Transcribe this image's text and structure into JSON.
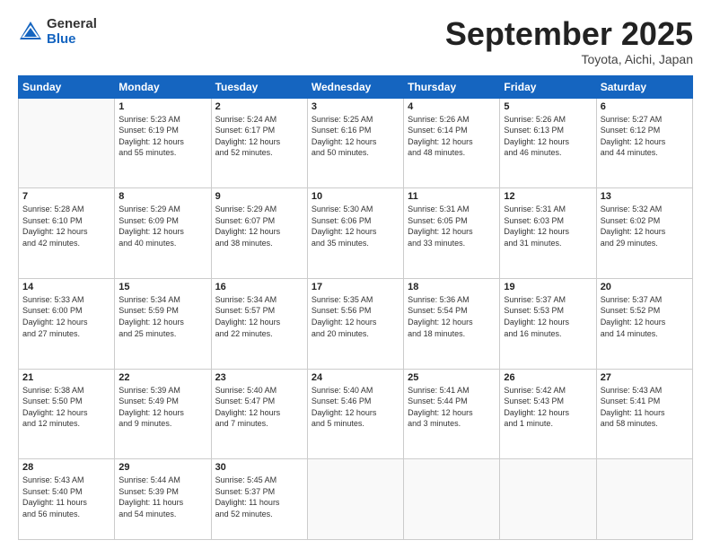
{
  "header": {
    "logo_general": "General",
    "logo_blue": "Blue",
    "month_title": "September 2025",
    "location": "Toyota, Aichi, Japan"
  },
  "calendar": {
    "days": [
      "Sunday",
      "Monday",
      "Tuesday",
      "Wednesday",
      "Thursday",
      "Friday",
      "Saturday"
    ],
    "weeks": [
      [
        {
          "day": "",
          "info": ""
        },
        {
          "day": "1",
          "info": "Sunrise: 5:23 AM\nSunset: 6:19 PM\nDaylight: 12 hours\nand 55 minutes."
        },
        {
          "day": "2",
          "info": "Sunrise: 5:24 AM\nSunset: 6:17 PM\nDaylight: 12 hours\nand 52 minutes."
        },
        {
          "day": "3",
          "info": "Sunrise: 5:25 AM\nSunset: 6:16 PM\nDaylight: 12 hours\nand 50 minutes."
        },
        {
          "day": "4",
          "info": "Sunrise: 5:26 AM\nSunset: 6:14 PM\nDaylight: 12 hours\nand 48 minutes."
        },
        {
          "day": "5",
          "info": "Sunrise: 5:26 AM\nSunset: 6:13 PM\nDaylight: 12 hours\nand 46 minutes."
        },
        {
          "day": "6",
          "info": "Sunrise: 5:27 AM\nSunset: 6:12 PM\nDaylight: 12 hours\nand 44 minutes."
        }
      ],
      [
        {
          "day": "7",
          "info": "Sunrise: 5:28 AM\nSunset: 6:10 PM\nDaylight: 12 hours\nand 42 minutes."
        },
        {
          "day": "8",
          "info": "Sunrise: 5:29 AM\nSunset: 6:09 PM\nDaylight: 12 hours\nand 40 minutes."
        },
        {
          "day": "9",
          "info": "Sunrise: 5:29 AM\nSunset: 6:07 PM\nDaylight: 12 hours\nand 38 minutes."
        },
        {
          "day": "10",
          "info": "Sunrise: 5:30 AM\nSunset: 6:06 PM\nDaylight: 12 hours\nand 35 minutes."
        },
        {
          "day": "11",
          "info": "Sunrise: 5:31 AM\nSunset: 6:05 PM\nDaylight: 12 hours\nand 33 minutes."
        },
        {
          "day": "12",
          "info": "Sunrise: 5:31 AM\nSunset: 6:03 PM\nDaylight: 12 hours\nand 31 minutes."
        },
        {
          "day": "13",
          "info": "Sunrise: 5:32 AM\nSunset: 6:02 PM\nDaylight: 12 hours\nand 29 minutes."
        }
      ],
      [
        {
          "day": "14",
          "info": "Sunrise: 5:33 AM\nSunset: 6:00 PM\nDaylight: 12 hours\nand 27 minutes."
        },
        {
          "day": "15",
          "info": "Sunrise: 5:34 AM\nSunset: 5:59 PM\nDaylight: 12 hours\nand 25 minutes."
        },
        {
          "day": "16",
          "info": "Sunrise: 5:34 AM\nSunset: 5:57 PM\nDaylight: 12 hours\nand 22 minutes."
        },
        {
          "day": "17",
          "info": "Sunrise: 5:35 AM\nSunset: 5:56 PM\nDaylight: 12 hours\nand 20 minutes."
        },
        {
          "day": "18",
          "info": "Sunrise: 5:36 AM\nSunset: 5:54 PM\nDaylight: 12 hours\nand 18 minutes."
        },
        {
          "day": "19",
          "info": "Sunrise: 5:37 AM\nSunset: 5:53 PM\nDaylight: 12 hours\nand 16 minutes."
        },
        {
          "day": "20",
          "info": "Sunrise: 5:37 AM\nSunset: 5:52 PM\nDaylight: 12 hours\nand 14 minutes."
        }
      ],
      [
        {
          "day": "21",
          "info": "Sunrise: 5:38 AM\nSunset: 5:50 PM\nDaylight: 12 hours\nand 12 minutes."
        },
        {
          "day": "22",
          "info": "Sunrise: 5:39 AM\nSunset: 5:49 PM\nDaylight: 12 hours\nand 9 minutes."
        },
        {
          "day": "23",
          "info": "Sunrise: 5:40 AM\nSunset: 5:47 PM\nDaylight: 12 hours\nand 7 minutes."
        },
        {
          "day": "24",
          "info": "Sunrise: 5:40 AM\nSunset: 5:46 PM\nDaylight: 12 hours\nand 5 minutes."
        },
        {
          "day": "25",
          "info": "Sunrise: 5:41 AM\nSunset: 5:44 PM\nDaylight: 12 hours\nand 3 minutes."
        },
        {
          "day": "26",
          "info": "Sunrise: 5:42 AM\nSunset: 5:43 PM\nDaylight: 12 hours\nand 1 minute."
        },
        {
          "day": "27",
          "info": "Sunrise: 5:43 AM\nSunset: 5:41 PM\nDaylight: 11 hours\nand 58 minutes."
        }
      ],
      [
        {
          "day": "28",
          "info": "Sunrise: 5:43 AM\nSunset: 5:40 PM\nDaylight: 11 hours\nand 56 minutes."
        },
        {
          "day": "29",
          "info": "Sunrise: 5:44 AM\nSunset: 5:39 PM\nDaylight: 11 hours\nand 54 minutes."
        },
        {
          "day": "30",
          "info": "Sunrise: 5:45 AM\nSunset: 5:37 PM\nDaylight: 11 hours\nand 52 minutes."
        },
        {
          "day": "",
          "info": ""
        },
        {
          "day": "",
          "info": ""
        },
        {
          "day": "",
          "info": ""
        },
        {
          "day": "",
          "info": ""
        }
      ]
    ]
  }
}
